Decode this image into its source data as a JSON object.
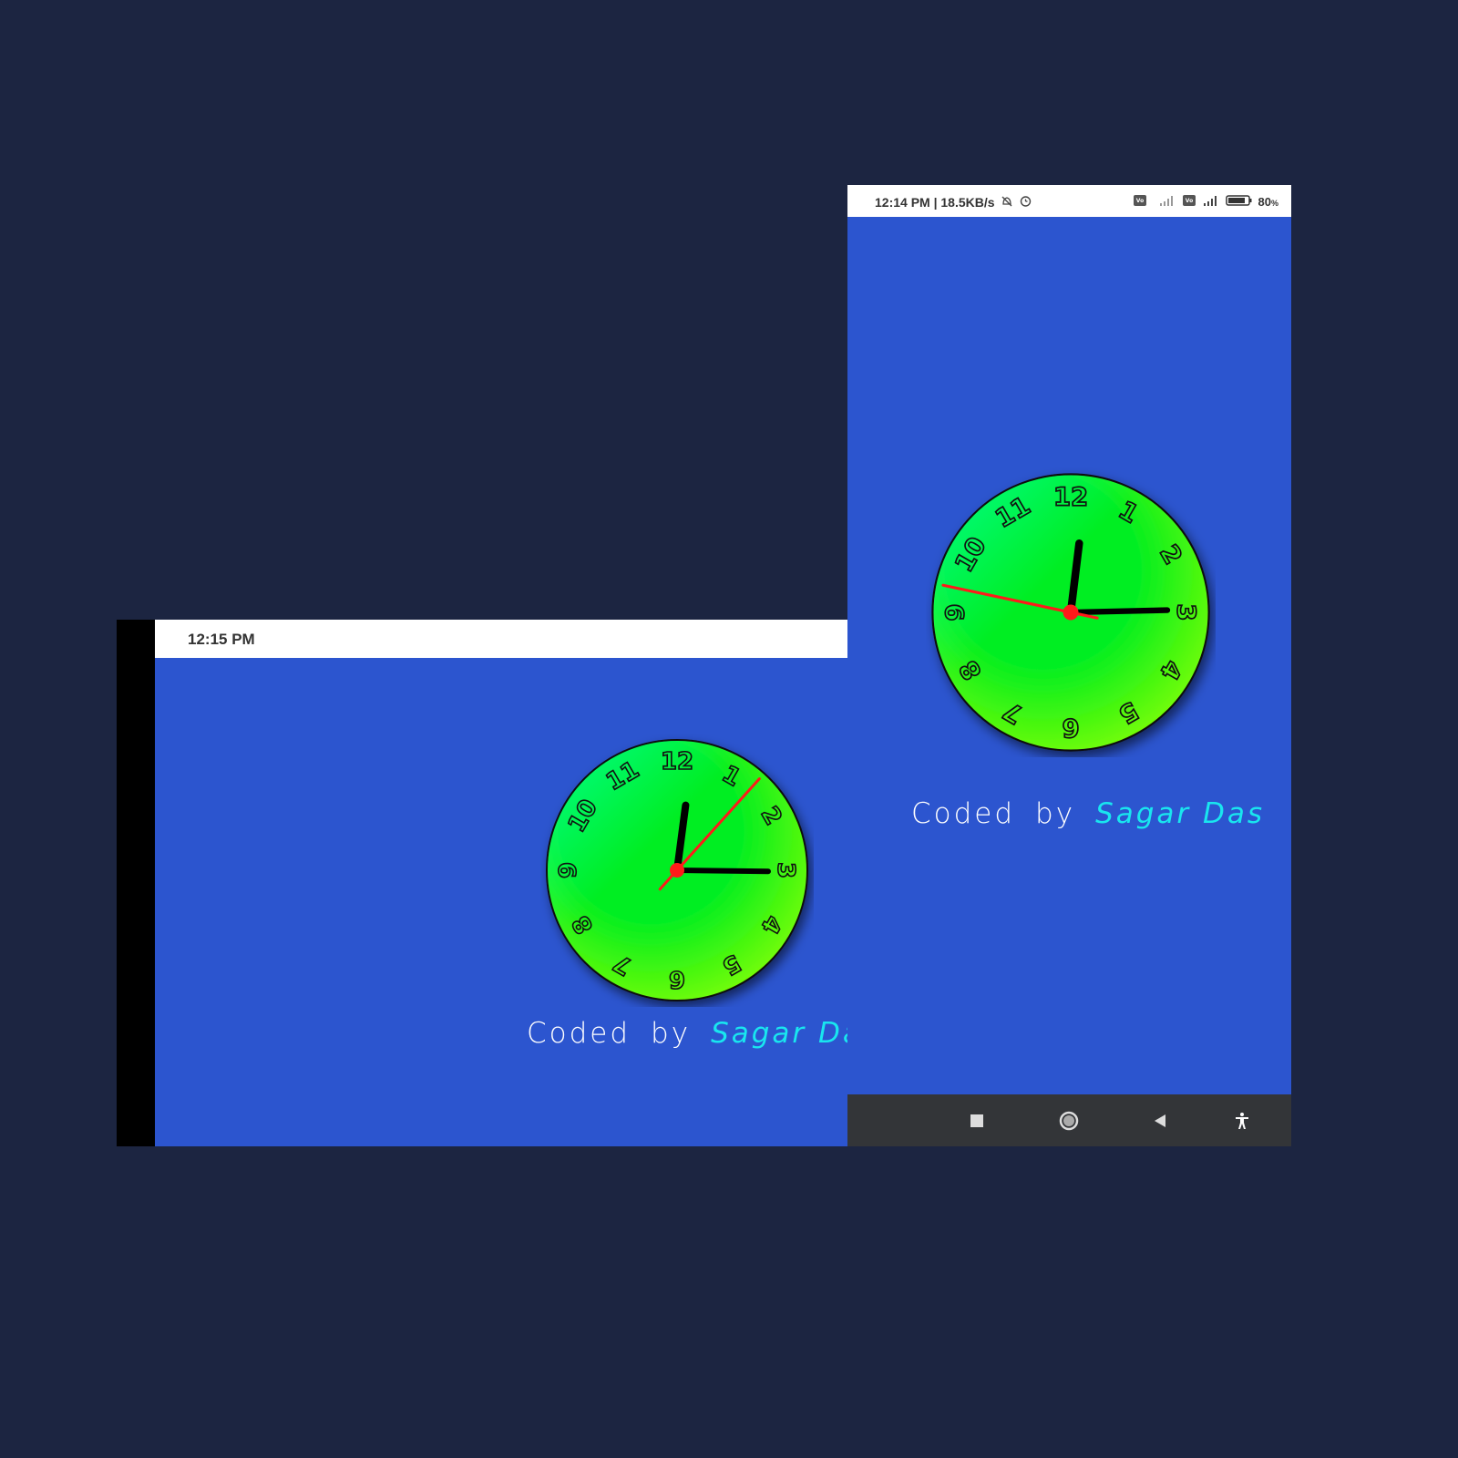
{
  "landscape": {
    "status_time": "12:15 PM",
    "clock_time": {
      "hours": 12,
      "minutes": 15,
      "seconds": 7
    },
    "credit": {
      "prefix": "Coded",
      "by": "by",
      "author": "Sagar Das"
    }
  },
  "portrait": {
    "status_left": "12:14 PM | 18.5KB/s",
    "status_battery": "80",
    "status_battery_unit": "%",
    "clock_time": {
      "hours": 12,
      "minutes": 14,
      "seconds": 47
    },
    "credit": {
      "prefix": "Coded",
      "by": "by",
      "author": "Sagar Das"
    },
    "nav": [
      "recents-button",
      "home-button",
      "back-button",
      "accessibility-button"
    ]
  },
  "clock_numerals": [
    "12",
    "1",
    "2",
    "3",
    "4",
    "5",
    "6",
    "7",
    "8",
    "9",
    "10",
    "11"
  ],
  "colors": {
    "background": "#1c2541",
    "app_background": "#2c55cf",
    "clock_face_light": "#00ff99",
    "clock_face_mid": "#00ee22",
    "clock_face_dark": "#88ff00",
    "second_hand": "#ff1a1a",
    "author_text": "#19e6ef"
  },
  "icons": [
    "mute-bell-icon",
    "alarm-icon",
    "volte-icon",
    "signal-icon",
    "battery-icon"
  ]
}
